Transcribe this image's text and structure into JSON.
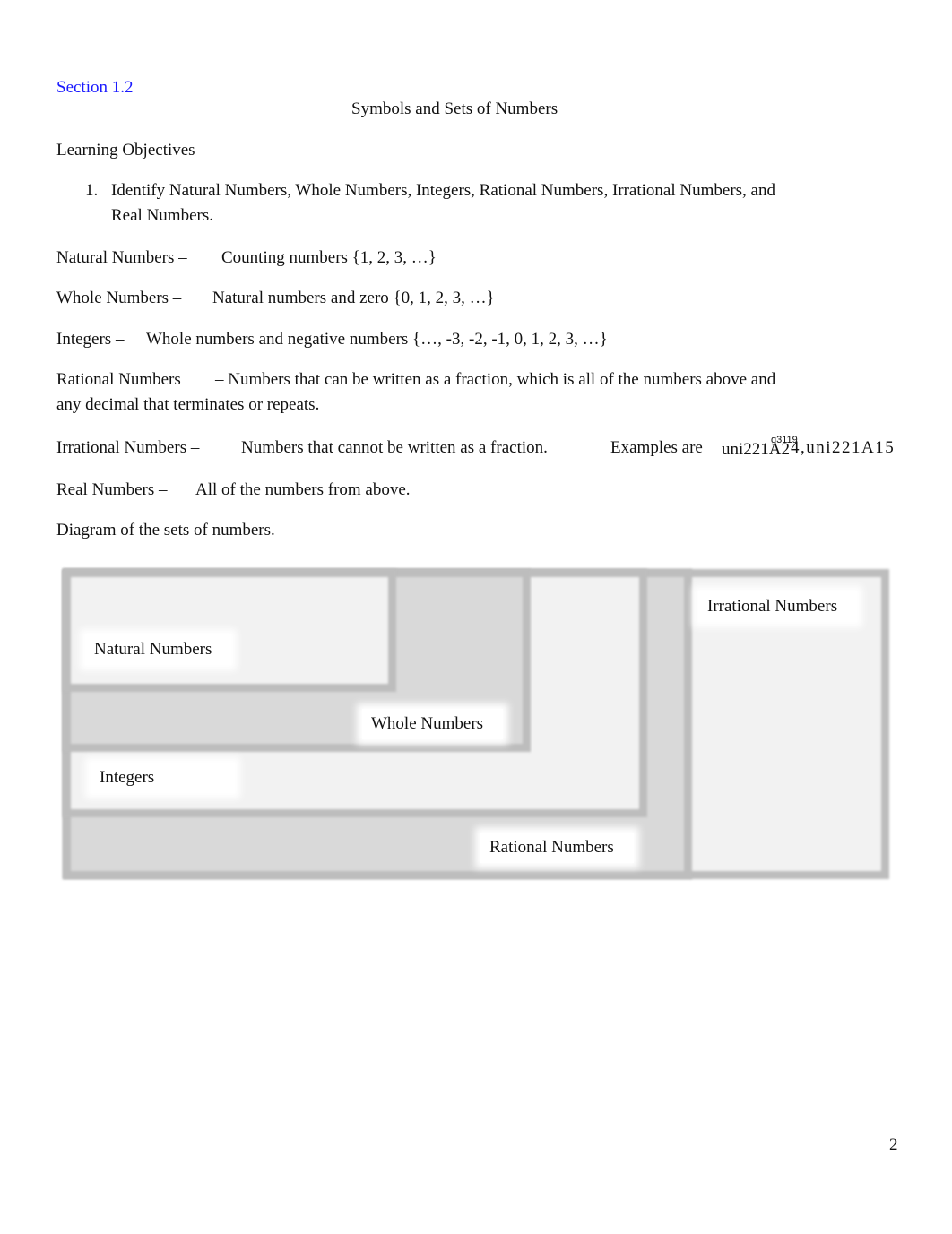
{
  "section_link": "Section 1.2",
  "title": "Symbols and Sets of Numbers",
  "objectives_heading": "Learning Objectives",
  "objectives": [
    {
      "num": "1.",
      "line1": "Identify Natural Numbers, Whole Numbers, Integers, Rational Numbers, Irrational Numbers, and",
      "line2": "Real Numbers."
    }
  ],
  "definitions": {
    "natural": {
      "term": "Natural Numbers –",
      "desc": "Counting numbers {1, 2, 3, …}"
    },
    "whole": {
      "term": "Whole Numbers –",
      "desc": "Natural numbers and zero {0, 1, 2, 3, …}"
    },
    "integers": {
      "term": "Integers –",
      "desc": "Whole numbers and negative numbers {…, -3, -2, -1, 0, 1, 2, 3, …}"
    },
    "rational": {
      "term": "Rational Numbers",
      "desc1": "– Numbers that can be written as a fraction, which is all of the numbers above and",
      "desc2": "any decimal that terminates or repeats."
    },
    "irrational": {
      "term": "Irrational Numbers –",
      "desc": "Numbers that cannot be written as a fraction.",
      "examples_label": "Examples are",
      "examples_glyphs": "uni221A2",
      "examples_overlap": "g3119",
      "examples_rest": "4,uni221A15"
    },
    "real": {
      "term": "Real Numbers –",
      "desc": "All of the numbers from above."
    }
  },
  "diagram_caption": "Diagram of the sets of numbers.",
  "diagram": {
    "natural": "Natural Numbers",
    "whole": "Whole Numbers",
    "integers": "Integers",
    "rational": "Rational Numbers",
    "irrational": "Irrational Numbers",
    "colors": {
      "light": "#f2f2f2",
      "dark": "#d9d9d9",
      "border": "#bdbdbd"
    }
  },
  "page_number": "2"
}
